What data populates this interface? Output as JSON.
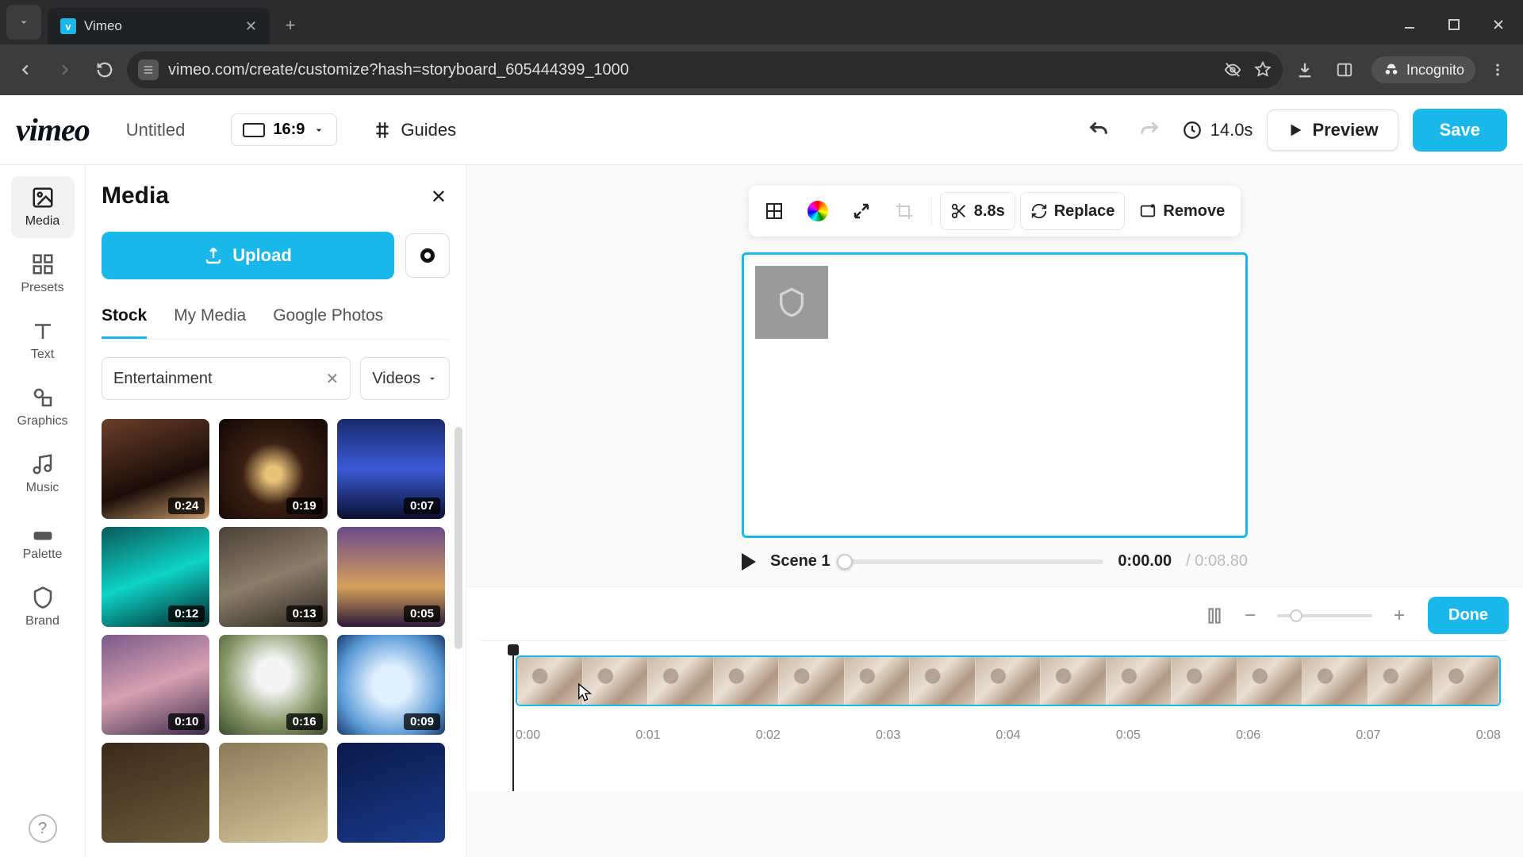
{
  "browser": {
    "tab_title": "Vimeo",
    "url": "vimeo.com/create/customize?hash=storyboard_605444399_1000",
    "incognito_label": "Incognito"
  },
  "header": {
    "logo": "vimeo",
    "title": "Untitled",
    "aspect": "16:9",
    "guides": "Guides",
    "duration": "14.0s",
    "preview": "Preview",
    "save": "Save"
  },
  "rail": {
    "items": [
      "Media",
      "Presets",
      "Text",
      "Graphics",
      "Music",
      "Palette",
      "Brand"
    ]
  },
  "panel": {
    "title": "Media",
    "upload": "Upload",
    "tabs": [
      "Stock",
      "My Media",
      "Google Photos"
    ],
    "active_tab": "Stock",
    "search": "Entertainment",
    "type": "Videos",
    "thumbs": [
      {
        "dur": "0:24",
        "bg": "linear-gradient(160deg,#6b3e2a,#1a0d08 60%,#c99b6b)"
      },
      {
        "dur": "0:19",
        "bg": "radial-gradient(circle at 50% 55%,#e9c27a 0 10%,#3a1f12 40%,#120805 100%)"
      },
      {
        "dur": "0:07",
        "bg": "linear-gradient(180deg,#1a2a6b,#3a5bd6 50%,#0a1030)"
      },
      {
        "dur": "0:12",
        "bg": "linear-gradient(160deg,#0a5a5a,#0dd3c7 50%,#032626)"
      },
      {
        "dur": "0:13",
        "bg": "linear-gradient(160deg,#4a4036,#8b7d6b 50%,#2a241d)"
      },
      {
        "dur": "0:05",
        "bg": "linear-gradient(180deg,#6b4a8a,#d6a05a 60%,#2a1a3a)"
      },
      {
        "dur": "0:10",
        "bg": "linear-gradient(160deg,#7a5a8a,#d6a0b0 50%,#3a2a4a)"
      },
      {
        "dur": "0:16",
        "bg": "radial-gradient(circle at 50% 40%,#f5f5f5 0 20%,#8a9a6b 60%,#3a4a2a)"
      },
      {
        "dur": "0:09",
        "bg": "radial-gradient(circle at 50% 50%,#e0f0ff 0 25%,#5a9ad6 70%,#1a3a6a)"
      },
      {
        "dur": "",
        "bg": "linear-gradient(160deg,#3a2a1a,#6b5a3a)"
      },
      {
        "dur": "",
        "bg": "linear-gradient(160deg,#8a7a5a,#d6c69a)"
      },
      {
        "dur": "",
        "bg": "linear-gradient(160deg,#0a1a4a,#1a3a8a)"
      }
    ]
  },
  "toolbar": {
    "trim": "8.8s",
    "replace": "Replace",
    "remove": "Remove"
  },
  "scene": {
    "label": "Scene 1",
    "current": "0:00.00",
    "total": "/ 0:08.80"
  },
  "timeline": {
    "done": "Done",
    "ticks": [
      "0:00",
      "0:01",
      "0:02",
      "0:03",
      "0:04",
      "0:05",
      "0:06",
      "0:07",
      "0:08"
    ]
  }
}
